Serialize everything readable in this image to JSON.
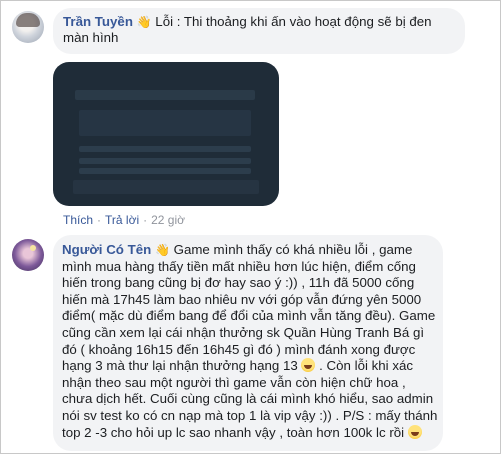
{
  "comments": [
    {
      "author": "Trần Tuyền",
      "author_icon": "waving-hand-icon",
      "text": " Lỗi : Thi thoảng khi ấn vào hoạt động sẽ bị đen màn hình",
      "actions": {
        "like": "Thích",
        "reply": "Trả lời",
        "separator": "·",
        "time": "22 giờ"
      }
    },
    {
      "author": "Người Có Tên",
      "author_icon": "waving-hand-icon",
      "text_1": " Game mình thấy có khá nhiều lỗi , game mình mua hàng thấy tiền mất nhiều hơn lúc hiện, điểm cống hiến trong bang cũng bị đơ hay sao ý :)) , 11h đã 5000 cống hiến mà 17h45 làm bao nhiêu nv với góp vẫn đứng yên 5000 điểm( mặc dù điểm bang để đổi của mình vẫn tăng đều). Game cũng cần xem lại cái nhận thưởng sk Quần Hùng Tranh Bá gì đó ( khoảng 16h15 đến 16h45 gì đó ) mình đánh xong được hạng 3 mà thư lại nhận thưởng hạng 13 ",
      "emoji_1": "grinning-sweat-emoji",
      "text_2": " . Còn lỗi khi xác nhận theo sau một người thì game vẫn còn hiện chữ hoa , chưa dịch hết. Cuối cùng cũng là cái mình khó hiểu, sao admin nói sv test ko có cn nạp mà top 1 là vip vậy :)) . P/S : mấy thánh top 2 -3 cho hỏi up lc sao nhanh vậy , toàn hơn 100k lc rồi ",
      "emoji_2": "grinning-sweat-emoji"
    }
  ],
  "colors": {
    "author": "#385898",
    "bubble": "#f2f3f5",
    "meta": "#90949c"
  }
}
